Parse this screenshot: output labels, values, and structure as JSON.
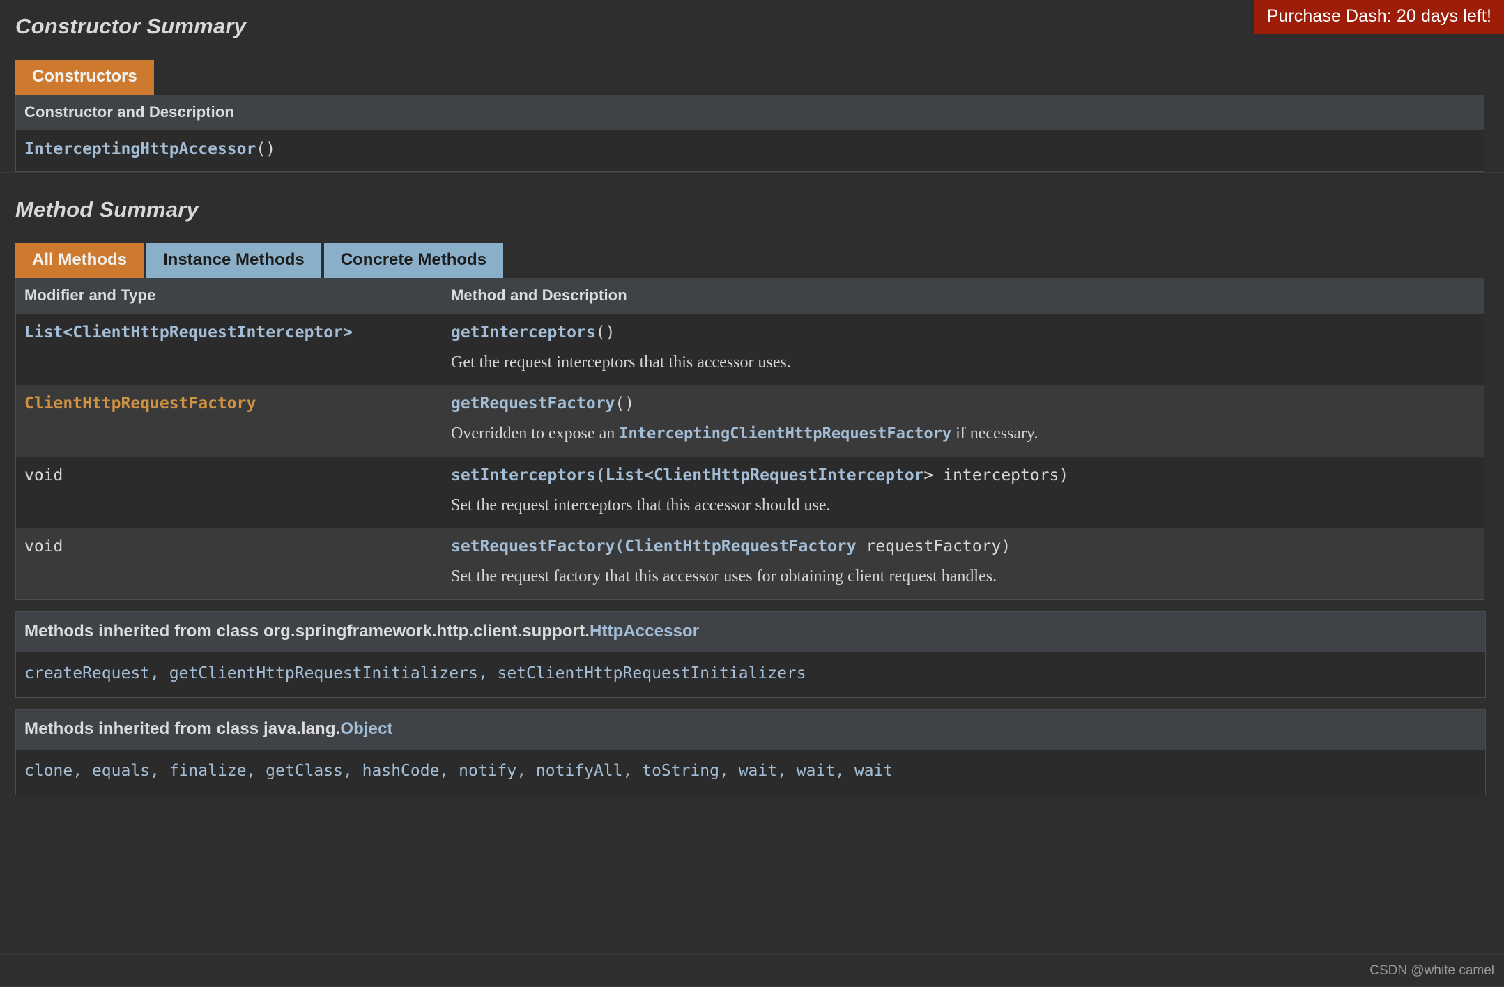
{
  "banner": {
    "text": "Purchase Dash: 20 days left!",
    "background_color": "#9e1d08",
    "text_color": "#ffffff"
  },
  "theme": {
    "page_background": "#2e2e2e",
    "row_background": "#2b2b2b",
    "row_alt_background": "#3a3a3a",
    "table_header_background": "#3f4347",
    "active_tab_color": "#cd7a2e",
    "inactive_tab_color": "#8ab0c9",
    "link_color": "#a3bdd6",
    "link_orange_color": "#cf9243",
    "text_color": "#d4d4d4"
  },
  "constructor_summary": {
    "title": "Constructor Summary",
    "tabs": [
      {
        "label": "Constructors",
        "active": true
      }
    ],
    "column_header": "Constructor and Description",
    "rows": [
      {
        "name": "InterceptingHttpAccessor",
        "signature_suffix": "()"
      }
    ]
  },
  "method_summary": {
    "title": "Method Summary",
    "tabs": [
      {
        "label": "All Methods",
        "active": true
      },
      {
        "label": "Instance Methods",
        "active": false
      },
      {
        "label": "Concrete Methods",
        "active": false
      }
    ],
    "columns": {
      "modifier_and_type": "Modifier and Type",
      "method_and_description": "Method and Description"
    },
    "rows": [
      {
        "type_prefix": "List<",
        "type_link": "ClientHttpRequestInterceptor",
        "type_suffix": ">",
        "type_is_link": true,
        "type_plain": "",
        "method_name": "getInterceptors",
        "method_params": "()",
        "method_param_link": "",
        "method_param_tail": "",
        "description_before": "Get the request interceptors that this accessor uses.",
        "description_link": "",
        "description_after": ""
      },
      {
        "type_prefix": "",
        "type_link": "ClientHttpRequestFactory",
        "type_suffix": "",
        "type_is_link": true,
        "type_plain": "",
        "method_name": "getRequestFactory",
        "method_params": "()",
        "method_param_link": "",
        "method_param_tail": "",
        "description_before": "Overridden to expose an ",
        "description_link": "InterceptingClientHttpRequestFactory",
        "description_after": " if necessary."
      },
      {
        "type_prefix": "",
        "type_link": "",
        "type_suffix": "",
        "type_is_link": false,
        "type_plain": "void",
        "method_name": "setInterceptors",
        "method_params": "(List<",
        "method_param_link": "ClientHttpRequestInterceptor",
        "method_param_tail": "> interceptors)",
        "description_before": "Set the request interceptors that this accessor should use.",
        "description_link": "",
        "description_after": ""
      },
      {
        "type_prefix": "",
        "type_link": "",
        "type_suffix": "",
        "type_is_link": false,
        "type_plain": "void",
        "method_name": "setRequestFactory",
        "method_params": "(",
        "method_param_link": "ClientHttpRequestFactory",
        "method_param_tail": " requestFactory)",
        "description_before": "Set the request factory that this accessor uses for obtaining client request handles.",
        "description_link": "",
        "description_after": ""
      }
    ]
  },
  "inherited_sections": [
    {
      "heading_plain": "Methods inherited from class org.springframework.http.client.support.",
      "heading_link": "HttpAccessor",
      "methods": "createRequest, getClientHttpRequestInitializers, setClientHttpRequestInitializers"
    },
    {
      "heading_plain": "Methods inherited from class java.lang.",
      "heading_link": "Object",
      "methods": "clone, equals, finalize, getClass, hashCode, notify, notifyAll, toString, wait, wait, wait"
    }
  ],
  "footer": {
    "watermark": "CSDN @white camel"
  }
}
